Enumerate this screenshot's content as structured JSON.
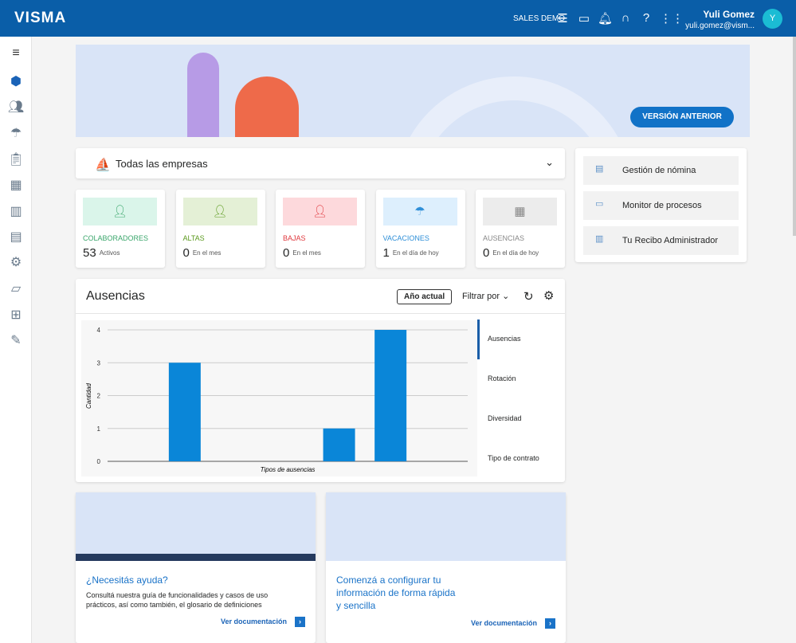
{
  "header": {
    "logo": "VISMA",
    "company": "SALES DEMO",
    "user_name": "Yuli Gomez",
    "user_email": "yuli.gomez@vism...",
    "avatar_initial": "Y"
  },
  "banner": {
    "button": "VERSIÓN ANTERIOR"
  },
  "company_selector": {
    "value": "Todas las empresas"
  },
  "stats": [
    {
      "label": "COLABORADORES",
      "value": "53",
      "sub": "Activos",
      "color": "#3aa66b",
      "bg": "#daf5ea",
      "icon": "users-check-icon"
    },
    {
      "label": "ALTAS",
      "value": "0",
      "sub": "En el mes",
      "color": "#5b9a1e",
      "bg": "#e4f0d6",
      "icon": "user-add-icon"
    },
    {
      "label": "BAJAS",
      "value": "0",
      "sub": "En el mes",
      "color": "#e0393e",
      "bg": "#fdd9dc",
      "icon": "user-remove-icon"
    },
    {
      "label": "VACACIONES",
      "value": "1",
      "sub": "En el día de hoy",
      "color": "#2f8fd8",
      "bg": "#ddeffd",
      "icon": "beach-icon"
    },
    {
      "label": "AUSENCIAS",
      "value": "0",
      "sub": "En el día de hoy",
      "color": "#888888",
      "bg": "#ececec",
      "icon": "calendar-icon"
    }
  ],
  "quick_links": [
    "Gestión de nómina",
    "Monitor de procesos",
    "Tu Recibo Administrador"
  ],
  "absences": {
    "title": "Ausencias",
    "year_button": "Año actual",
    "filter": "Filtrar por",
    "tabs": [
      "Ausencias",
      "Rotación",
      "Diversidad",
      "Tipo de contrato"
    ]
  },
  "chart_data": {
    "type": "bar",
    "categories": [
      "",
      "",
      "",
      "",
      "",
      "",
      ""
    ],
    "values": [
      0,
      3,
      0,
      0,
      1,
      4,
      0
    ],
    "xlabel": "Tipos de ausencias",
    "ylabel": "Cantidad",
    "ylim": [
      0,
      4
    ],
    "yticks": [
      0,
      1,
      2,
      3,
      4
    ],
    "color": "#0a86d8",
    "grid": true
  },
  "help_cards": [
    {
      "title": "¿Necesitás ayuda?",
      "text": "Consultá nuestra guía de funcionalidades y casos de uso prácticos, así como también, el glosario de definiciones",
      "link": "Ver documentación"
    },
    {
      "title": "Comenzá a configurar tu información de forma rápida y sencilla",
      "link": "Ver documentación"
    }
  ]
}
